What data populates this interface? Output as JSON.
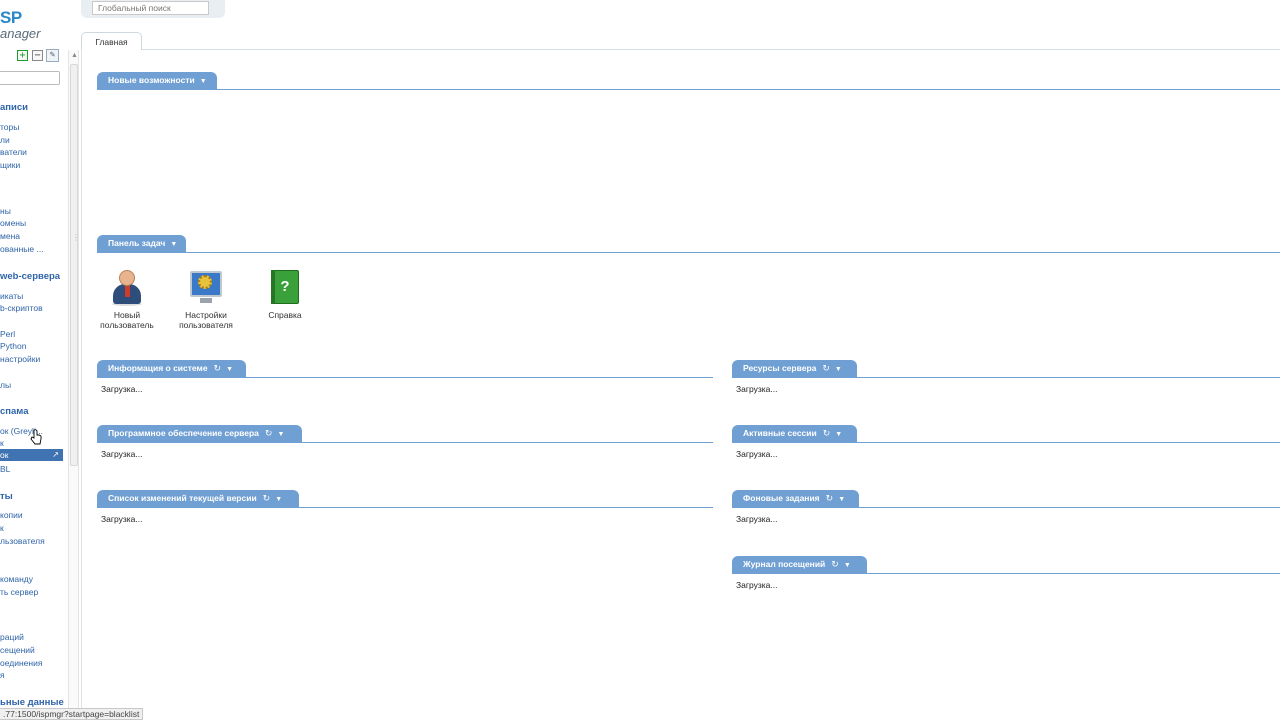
{
  "logo": {
    "isp": "SP",
    "manager": "anager"
  },
  "sidebar": {
    "search_placeholder": "",
    "sections": [
      {
        "label": "аписи"
      },
      {
        "label": "web-сервера"
      },
      {
        "label": "спама"
      },
      {
        "label": "ты"
      },
      {
        "label": "ьные данные"
      }
    ],
    "items": [
      {
        "label": "торы"
      },
      {
        "label": "ли"
      },
      {
        "label": "ватели"
      },
      {
        "label": "щики"
      },
      {
        "label": "ны"
      },
      {
        "label": "омены"
      },
      {
        "label": "мена"
      },
      {
        "label": "ованные ..."
      },
      {
        "label": "икаты"
      },
      {
        "label": "b-скриптов"
      },
      {
        "label": " Perl"
      },
      {
        "label": " Python"
      },
      {
        "label": "настройки"
      },
      {
        "label": "лы"
      },
      {
        "label": "ок (Greyli..."
      },
      {
        "label": "к"
      },
      {
        "label": "BL"
      },
      {
        "label": "копии"
      },
      {
        "label": "к"
      },
      {
        "label": "льзователя"
      },
      {
        "label": "команду"
      },
      {
        "label": "ть сервер"
      },
      {
        "label": "раций"
      },
      {
        "label": "сещений"
      },
      {
        "label": "оединения"
      },
      {
        "label": "я"
      }
    ],
    "active_item": {
      "label": "ок"
    }
  },
  "global_search": {
    "placeholder": "Глобальный поиск"
  },
  "tabs": [
    {
      "label": "Главная"
    }
  ],
  "widgets": {
    "new_features": {
      "title": "Новые возможности"
    },
    "task_panel": {
      "title": "Панель задач"
    },
    "system_info": {
      "title": "Информация о системе",
      "body": "Загрузка..."
    },
    "software": {
      "title": "Программное обеспечение сервера",
      "body": "Загрузка..."
    },
    "changelog": {
      "title": "Список изменений текущей версии",
      "body": "Загрузка..."
    },
    "resources": {
      "title": "Ресурсы сервера",
      "body": "Загрузка..."
    },
    "sessions": {
      "title": "Активные сессии",
      "body": "Загрузка..."
    },
    "background": {
      "title": "Фоновые задания",
      "body": "Загрузка..."
    },
    "visits": {
      "title": "Журнал посещений",
      "body": "Загрузка..."
    }
  },
  "tasks": [
    {
      "line1": "Новый",
      "line2": "пользователь",
      "icon": "user-icon"
    },
    {
      "line1": "Настройки",
      "line2": "пользователя",
      "icon": "settings-icon"
    },
    {
      "line1": "Справка",
      "line2": "",
      "icon": "help-icon"
    }
  ],
  "status_bar": {
    "url": ".77:1500/ispmgr?startpage=blacklist"
  },
  "colors": {
    "accent": "#6f9fd3",
    "link": "#2f64a8",
    "active": "#3f73b1"
  }
}
